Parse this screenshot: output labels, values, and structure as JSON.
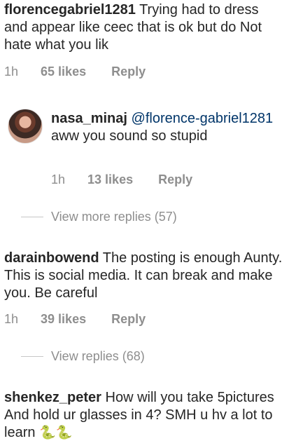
{
  "comments": [
    {
      "username": "florencegabriel1281",
      "text": " Trying had to dress and appear like ceec that is ok but do Not hate what you lik",
      "time": "1h",
      "likes": "65 likes",
      "reply": "Reply"
    },
    {
      "username": "nasa_minaj",
      "mention": "@florence-gabriel1281",
      "text": " aww you sound so stupid",
      "time": "1h",
      "likes": "13 likes",
      "reply": "Reply"
    },
    {
      "username": "darainbowend",
      "text": " The posting is enough Aunty. This is social media. It can break and make you. Be careful",
      "time": "1h",
      "likes": "39 likes",
      "reply": "Reply"
    },
    {
      "username": "shenkez_peter",
      "text": " How will you take 5pictures And hold ur glasses in 4? SMH u hv a lot to learn ",
      "emoji": "🐍🐍"
    }
  ],
  "view_more_replies": "View more replies (57)",
  "view_replies": "View replies (68)"
}
